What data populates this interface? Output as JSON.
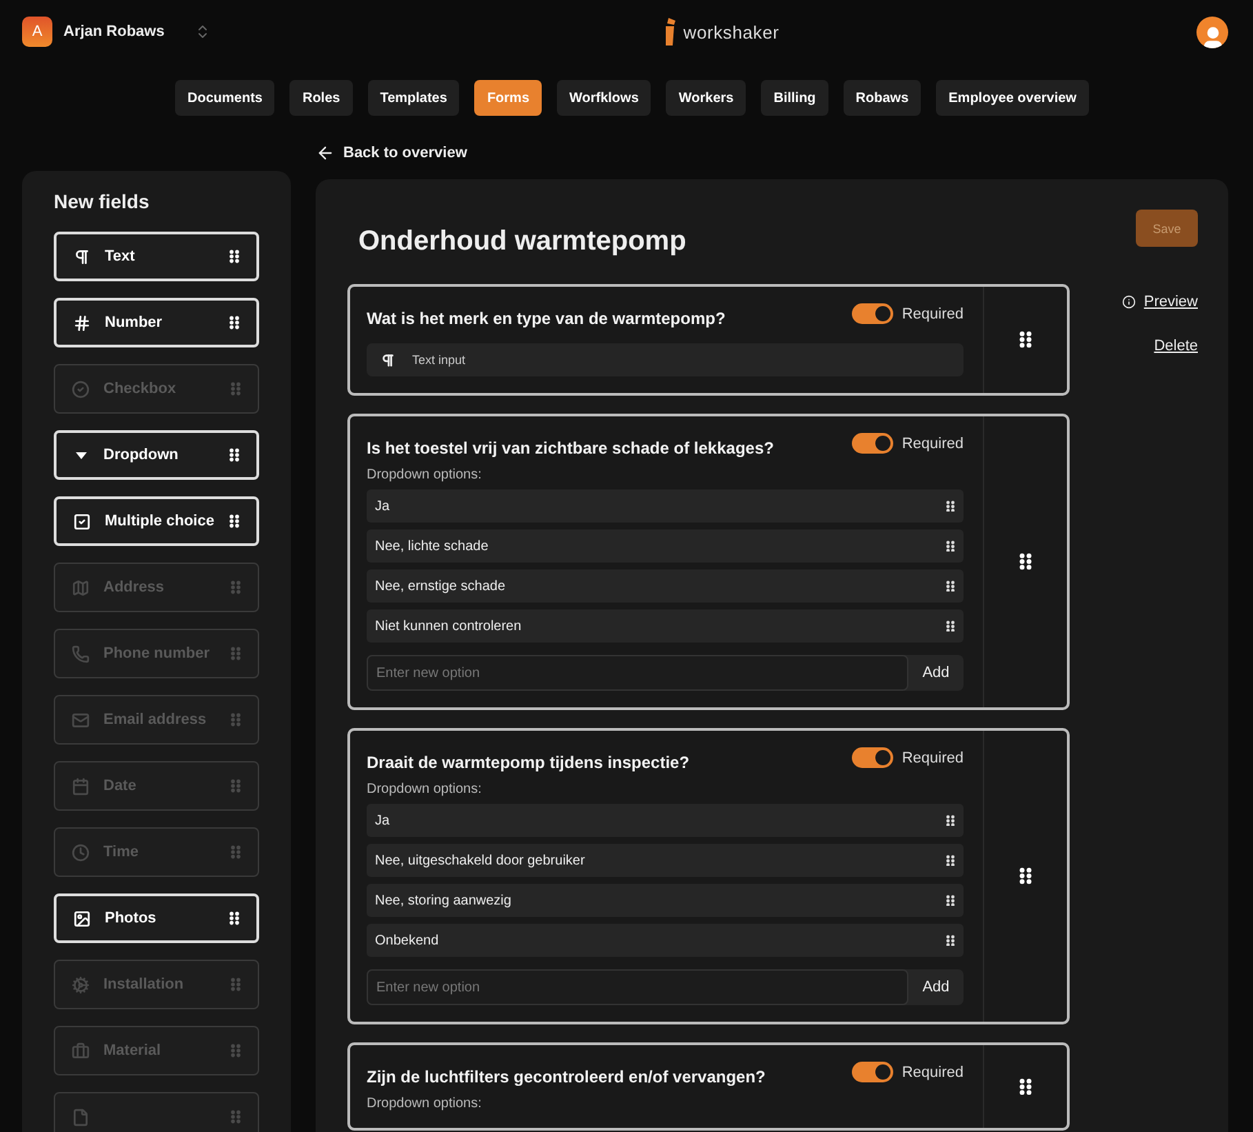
{
  "account": {
    "initial": "A",
    "name": "Arjan Robaws"
  },
  "logo": {
    "text": "workshaker"
  },
  "nav": [
    {
      "label": "Documents",
      "selected": false
    },
    {
      "label": "Roles",
      "selected": false
    },
    {
      "label": "Templates",
      "selected": false
    },
    {
      "label": "Forms",
      "selected": true
    },
    {
      "label": "Worfklows",
      "selected": false
    },
    {
      "label": "Workers",
      "selected": false
    },
    {
      "label": "Billing",
      "selected": false
    },
    {
      "label": "Robaws",
      "selected": false
    },
    {
      "label": "Employee overview",
      "selected": false
    }
  ],
  "back_link": "Back to overview",
  "sidebar": {
    "title": "New fields",
    "items": [
      {
        "kind": "text",
        "label": "Text",
        "disabled": false
      },
      {
        "kind": "number",
        "label": "Number",
        "disabled": false
      },
      {
        "kind": "checkbox",
        "label": "Checkbox",
        "disabled": true
      },
      {
        "kind": "dropdown",
        "label": "Dropdown",
        "disabled": false
      },
      {
        "kind": "multiple",
        "label": "Multiple choice",
        "disabled": false
      },
      {
        "kind": "address",
        "label": "Address",
        "disabled": true
      },
      {
        "kind": "phone",
        "label": "Phone number",
        "disabled": true
      },
      {
        "kind": "email",
        "label": "Email address",
        "disabled": true
      },
      {
        "kind": "date",
        "label": "Date",
        "disabled": true
      },
      {
        "kind": "time",
        "label": "Time",
        "disabled": true
      },
      {
        "kind": "photos",
        "label": "Photos",
        "disabled": false
      },
      {
        "kind": "installation",
        "label": "Installation",
        "disabled": true
      },
      {
        "kind": "material",
        "label": "Material",
        "disabled": true
      },
      {
        "kind": "file",
        "disabled": true
      }
    ]
  },
  "form": {
    "title": "Onderhoud warmtepomp",
    "save": "Save",
    "preview": "Preview",
    "delete": "Delete",
    "questions": [
      {
        "kind": "text",
        "question": "Wat is het merk en type van de warmtepomp?",
        "required": true,
        "required_label": "Required",
        "input_label": "Text input"
      },
      {
        "kind": "dropdown",
        "question": "Is het toestel vrij van zichtbare schade of lekkages?",
        "required": true,
        "required_label": "Required",
        "options_label": "Dropdown options:",
        "options": [
          "Ja",
          "Nee, lichte schade",
          "Nee, ernstige schade",
          "Niet kunnen controleren"
        ],
        "new_option_placeholder": "Enter new option",
        "add": "Add"
      },
      {
        "kind": "dropdown",
        "question": "Draait de warmtepomp tijdens inspectie?",
        "required": true,
        "required_label": "Required",
        "options_label": "Dropdown options:",
        "options": [
          "Ja",
          "Nee, uitgeschakeld door gebruiker",
          "Nee, storing aanwezig",
          "Onbekend"
        ],
        "new_option_placeholder": "Enter new option",
        "add": "Add"
      },
      {
        "kind": "dropdown",
        "question": "Zijn de luchtfilters gecontroleerd en/of vervangen?",
        "required": true,
        "required_label": "Required",
        "options_label": "Dropdown options:"
      }
    ]
  }
}
